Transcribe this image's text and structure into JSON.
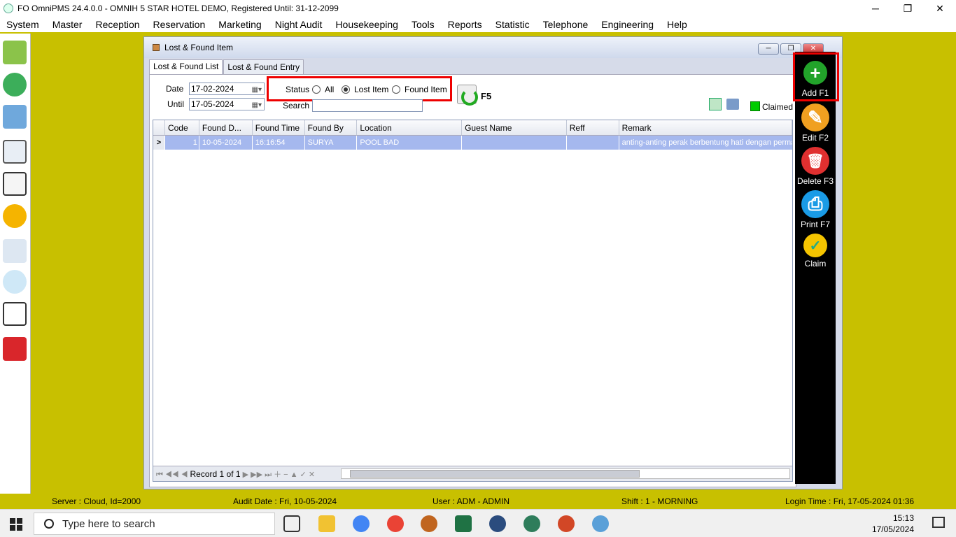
{
  "app": {
    "title": "FO OmniPMS 24.4.0.0 - OMNIH 5 STAR HOTEL DEMO, Registered Until: 31-12-2099",
    "win_min": "─",
    "win_max": "❐",
    "win_close": "✕"
  },
  "menu": [
    "System",
    "Master",
    "Reception",
    "Reservation",
    "Marketing",
    "Night Audit",
    "Housekeeping",
    "Tools",
    "Reports",
    "Statistic",
    "Telephone",
    "Engineering",
    "Help"
  ],
  "left_toolbar": [
    "walk-icon",
    "users-icon",
    "layout-icon",
    "calendar-grid-icon",
    "calendar-2023-icon",
    "available-badge-icon",
    "housekeeping-icon",
    "search-chart-icon",
    "statistics-icon",
    "exit-icon"
  ],
  "child_window": {
    "title": "Lost & Found Item",
    "tabs": [
      "Lost & Found List",
      "Lost & Found Entry"
    ],
    "filter": {
      "date_label": "Date",
      "date_value": "17-02-2024",
      "until_label": "Until",
      "until_value": "17-05-2024",
      "status_label": "Status",
      "options": [
        "All",
        "Lost Item",
        "Found Item"
      ],
      "selected": "Lost Item",
      "search_label": "Search",
      "search_value": "",
      "refresh_key": "F5",
      "claimed_label": "Claimed",
      "claimed_color": "#00cc00"
    },
    "grid": {
      "columns": [
        "Code",
        "Found D...",
        "Found Time",
        "Found By",
        "Location",
        "Guest Name",
        "Reff",
        "Remark"
      ],
      "rows": [
        [
          "1",
          "10-05-2024",
          "16:16:54",
          "SURYA",
          "POOL BAD",
          "",
          "",
          "anting-anting perak berbentung hati dengan perma"
        ]
      ],
      "row_indicator": ">",
      "navigator": "⏮ ◀◀ ◀",
      "record_text": "Record 1 of 1",
      "navigator_after": "▶ ▶▶ ⏭ ＋ − ▲ ✓ ✕"
    }
  },
  "actions": [
    {
      "label": "Add F1",
      "color": "#22a32a",
      "glyph": "+"
    },
    {
      "label": "Edit F2",
      "color": "#f0a020",
      "glyph": "✎"
    },
    {
      "label": "Delete F3",
      "color": "#e03030",
      "glyph": "🗑"
    },
    {
      "label": "Print F7",
      "color": "#1a9be6",
      "glyph": "⎙"
    },
    {
      "label": "Claim",
      "color": "#f5c400",
      "glyph": "✓"
    }
  ],
  "status_bar": {
    "server": "Server : Cloud, Id=2000",
    "audit": "Audit Date : Fri, 10-05-2024",
    "user": "User : ADM - ADMIN",
    "shift": "Shift : 1 - MORNING",
    "login": "Login Time : Fri, 17-05-2024 01:36"
  },
  "taskbar": {
    "search_placeholder": "Type here to search",
    "time": "15:13",
    "date": "17/05/2024"
  }
}
